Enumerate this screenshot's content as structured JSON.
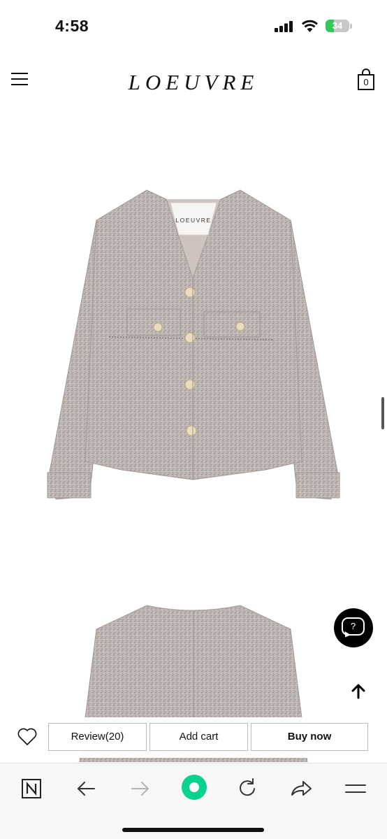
{
  "status_bar": {
    "time": "4:58",
    "battery": "34",
    "battery_level": 0.34,
    "battery_color": "#34c759"
  },
  "header": {
    "brand": "LOEUVRE",
    "cart_count": "0",
    "icons": {
      "menu": "hamburger-icon",
      "cart": "shopping-bag-icon"
    }
  },
  "product": {
    "images": [
      {
        "label": "LOEUVRE",
        "description_icon": "tweed-jacket-front-image"
      },
      {
        "description_icon": "tweed-jacket-back-image"
      }
    ],
    "tweed_color": "#b8b0ad"
  },
  "floating": {
    "chat_icon": "?",
    "top_icon": "arrow-up-icon"
  },
  "purchase_bar": {
    "review_label": "Review(20)",
    "add_cart_label": "Add cart",
    "buy_now_label": "Buy now",
    "wishlist_icon": "heart-icon"
  },
  "browser_toolbar": {
    "icons": [
      "naver-logo-icon",
      "back-arrow-icon",
      "forward-arrow-icon",
      "home-dot-icon",
      "reload-icon",
      "share-icon",
      "menu-icon"
    ],
    "home_color": "#08d38c"
  }
}
